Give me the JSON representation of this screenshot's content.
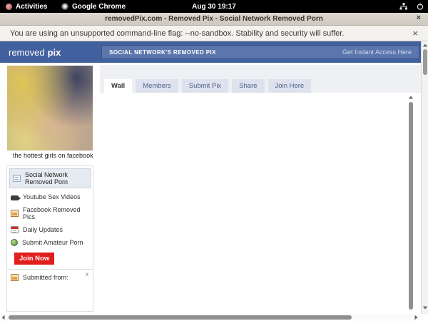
{
  "system_bar": {
    "activities_label": "Activities",
    "app_label": "Google Chrome",
    "clock": "Aug 30 19:17"
  },
  "browser": {
    "window_title": "removedPix.com - Removed Pix - Social Network Removed Porn",
    "window_close": "×",
    "infobar_message": "You are using an unsupported command-line flag: --no-sandbox. Stability and security will suffer.",
    "infobar_close": "×"
  },
  "site": {
    "logo_normal": "removed",
    "logo_bold": "pix",
    "banner_title": "SOCIAL NETWORK'S REMOVED PIX",
    "banner_link": "Get Instant Access Here",
    "colors": {
      "header_blue": "#41609e",
      "banner_blue": "#5b76ad",
      "join_red": "#e21d1d",
      "tab_inactive": "#dde2ee"
    }
  },
  "sidebar": {
    "photo_caption": "the hottest girls on facebook",
    "menu": [
      {
        "label": "Social Network Removed Porn",
        "icon": "wall-icon",
        "active": true
      },
      {
        "label": "Youtube Sex Videos",
        "icon": "video-camera-icon",
        "active": false
      },
      {
        "label": "Facebook Removed Pics",
        "icon": "photo-icon",
        "active": false
      },
      {
        "label": "Daily Updates",
        "icon": "calendar-icon",
        "active": false
      },
      {
        "label": "Submit Amateur Porn",
        "icon": "globe-icon",
        "active": false
      }
    ],
    "join_button_label": "Join Now",
    "submitted_from_label": "Submitted from:",
    "submitted_close": "x"
  },
  "main": {
    "tabs": [
      {
        "label": "Wall",
        "active": true
      },
      {
        "label": "Members",
        "active": false
      },
      {
        "label": "Submit Pix",
        "active": false
      },
      {
        "label": "Share",
        "active": false
      },
      {
        "label": "Join Here",
        "active": false
      }
    ]
  }
}
